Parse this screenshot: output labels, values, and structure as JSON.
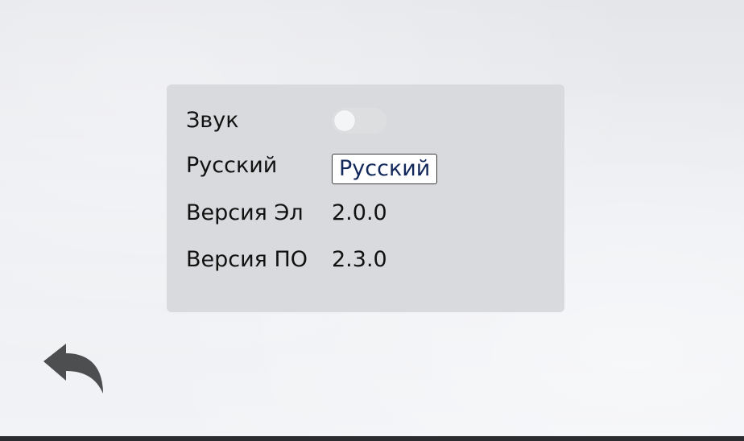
{
  "settings": {
    "sound": {
      "label": "Звук",
      "enabled": false
    },
    "language": {
      "label": "Русский",
      "value": "Русский"
    },
    "hw_version": {
      "label": "Версия Эл",
      "value": "2.0.0"
    },
    "sw_version": {
      "label": "Версия ПО",
      "value": "2.3.0"
    }
  },
  "navigation": {
    "back_icon": "back-arrow-icon"
  },
  "colors": {
    "panel": "#d9dadd",
    "background": "#eceef2",
    "text": "#111111",
    "button_text": "#12285a",
    "icon": "#4d4e50"
  }
}
